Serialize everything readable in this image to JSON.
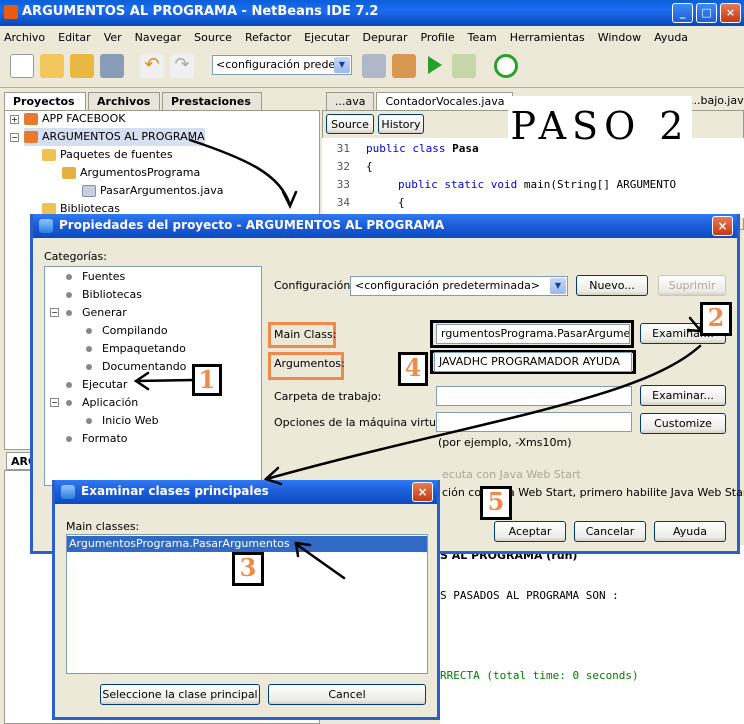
{
  "window": {
    "title": "ARGUMENTOS AL PROGRAMA - NetBeans IDE 7.2"
  },
  "menu": [
    "Archivo",
    "Editar",
    "Ver",
    "Navegar",
    "Source",
    "Refactor",
    "Ejecutar",
    "Depurar",
    "Profile",
    "Team",
    "Herramientas",
    "Window",
    "Ayuda"
  ],
  "toolbar": {
    "config_combo": "<configuración prede..."
  },
  "left_tabs": [
    "Proyectos",
    "Archivos",
    "Prestaciones"
  ],
  "project_tree": {
    "items": [
      "APP FACEBOOK",
      "ARGUMENTOS AL PROGRAMA",
      "Paquetes de fuentes",
      "ArgumentosPrograma",
      "PasarArgumentos.java",
      "Bibliotecas"
    ],
    "bottom_tab": "ARG"
  },
  "editor": {
    "tabs": [
      "...ava",
      "ContadorVocales.java",
      "...bajo.java"
    ],
    "subtabs": [
      "Source",
      "History"
    ],
    "paso_label": "PASO 2",
    "lines": [
      {
        "n": "31",
        "kw": "public class ",
        "rest": "Pasa"
      },
      {
        "n": "32",
        "kw": "",
        "rest": "{"
      },
      {
        "n": "33",
        "kw": "public static void ",
        "rest": "main(String[] ARGUMENTO"
      },
      {
        "n": "34",
        "kw": "",
        "rest": "{"
      }
    ]
  },
  "properties_dialog": {
    "title": "Propiedades del proyecto - ARGUMENTOS AL PROGRAMA",
    "categories_label": "Categorías:",
    "categories": [
      "Fuentes",
      "Bibliotecas",
      "Generar",
      "Compilando",
      "Empaquetando",
      "Documentando",
      "Ejecutar",
      "Aplicación",
      "Inicio Web",
      "Formato"
    ],
    "config_label": "Configuración:",
    "config_value": "<configuración predeterminada>",
    "new_button": "Nuevo...",
    "delete_button": "Suprimir",
    "main_class_label": "Main Class:",
    "main_class_value": "rgumentosPrograma.PasarArgumentos",
    "browse_button": "Examinar...",
    "args_label": "Argumentos:",
    "args_value": "JAVADHC PROGRAMADOR AYUDA",
    "workdir_label": "Carpeta de trabajo:",
    "workdir_button": "Examinar...",
    "vm_label": "Opciones de la máquina virtual:",
    "vm_button": "Customize",
    "vm_hint": "(por ejemplo, -Xms10m)",
    "webstart_check": "ecuta con Java Web Start",
    "webstart_note": "ción con Java Web Start, primero habilite Java Web Start)",
    "ok_button": "Aceptar",
    "cancel_button": "Cancelar",
    "help_button": "Ayuda"
  },
  "browse_dialog": {
    "title": "Examinar clases principales",
    "list_label": "Main classes:",
    "items": [
      "ArgumentosPrograma.PasarArgumentos"
    ],
    "select_button": "Seleccione la clase principal",
    "cancel_button": "Cancel"
  },
  "output": {
    "header": "S AL PROGRAMA (run)",
    "line1": "S PASADOS AL PROGRAMA SON :",
    "line2": "RRECTA (total time: 0 seconds)"
  },
  "markers": [
    "1",
    "2",
    "3",
    "4",
    "5"
  ],
  "colors": {
    "accent": "#f08a4b",
    "xp_blue": "#2c60c9",
    "keyword": "#0000e6",
    "success": "#008000"
  }
}
